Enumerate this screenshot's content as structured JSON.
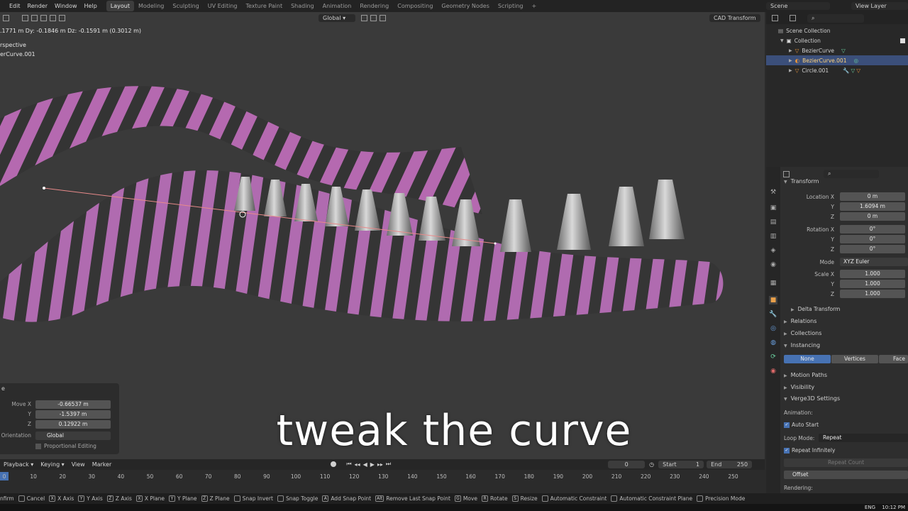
{
  "app": {
    "menus": [
      "Edit",
      "Render",
      "Window",
      "Help"
    ],
    "workspaces": [
      "Layout",
      "Modeling",
      "Sculpting",
      "UV Editing",
      "Texture Paint",
      "Shading",
      "Animation",
      "Rendering",
      "Compositing",
      "Geometry Nodes",
      "Scripting"
    ],
    "active_workspace": "Layout",
    "add_tab": "+",
    "scene": "Scene",
    "view_layer": "View Layer"
  },
  "viewport": {
    "transform_readout": ".1771 m  Dy: -0.1846 m  Dz: -0.1591 m (0.3012 m)",
    "view_name": "rspective",
    "object_name": "erCurve.001",
    "orientation": "Global",
    "transform_mode": "CAD Transform",
    "colors": {
      "stripe_pink": "#b569b0",
      "stripe_dark": "#333333",
      "curve_line": "#e88a8a"
    }
  },
  "operator_panel": {
    "title": "e",
    "move_x_label": "Move X",
    "move_x": "-0.66537 m",
    "y_label": "Y",
    "y": "-1.5397 m",
    "z_label": "Z",
    "z": "0.12922 m",
    "orientation_label": "Orientation",
    "orientation": "Global",
    "proportional_label": "Proportional Editing"
  },
  "subtitle": "tweak the curve",
  "outliner": {
    "scene_collection": "Scene Collection",
    "collection": "Collection",
    "items": [
      {
        "name": "BezierCurve",
        "selected": false
      },
      {
        "name": "BezierCurve.001",
        "selected": true
      },
      {
        "name": "Circle.001",
        "selected": false
      }
    ]
  },
  "properties": {
    "transform_title": "Transform",
    "location_label": "Location X",
    "location": [
      "0 m",
      "1.6094 m",
      "0 m"
    ],
    "rotation_label": "Rotation X",
    "rotation": [
      "0°",
      "0°",
      "0°"
    ],
    "mode_label": "Mode",
    "mode": "XYZ Euler",
    "scale_label": "Scale X",
    "scale": [
      "1.000",
      "1.000",
      "1.000"
    ],
    "y_label": "Y",
    "z_label": "Z",
    "delta_transform": "Delta Transform",
    "relations": "Relations",
    "collections": "Collections",
    "instancing": "Instancing",
    "instancing_options": [
      "None",
      "Vertices",
      "Face"
    ],
    "motion_paths": "Motion Paths",
    "visibility": "Visibility",
    "verge3d": "Verge3D Settings",
    "animation_label": "Animation:",
    "auto_start": "Auto Start",
    "loop_mode_label": "Loop Mode:",
    "loop_mode": "Repeat",
    "repeat_infinitely": "Repeat Infinitely",
    "repeat_count": "Repeat Count",
    "offset": "Offset",
    "rendering_label": "Rendering:"
  },
  "timeline": {
    "menus": [
      "Playback",
      "Keying",
      "View",
      "Marker"
    ],
    "current_frame": "0",
    "start_label": "Start",
    "start": "1",
    "end_label": "End",
    "end": "250",
    "ticks": [
      "0",
      "10",
      "20",
      "30",
      "40",
      "50",
      "60",
      "70",
      "80",
      "90",
      "100",
      "110",
      "120",
      "130",
      "140",
      "150",
      "160",
      "170",
      "180",
      "190",
      "200",
      "210",
      "220",
      "230",
      "240",
      "250"
    ]
  },
  "statusbar": {
    "items": [
      {
        "key": "",
        "label": "nfirm"
      },
      {
        "key": "",
        "label": "Cancel"
      },
      {
        "key": "X",
        "label": "X Axis"
      },
      {
        "key": "Y",
        "label": "Y Axis"
      },
      {
        "key": "Z",
        "label": "Z Axis"
      },
      {
        "key": "X",
        "label": "X Plane"
      },
      {
        "key": "Y",
        "label": "Y Plane"
      },
      {
        "key": "Z",
        "label": "Z Plane"
      },
      {
        "key": "",
        "label": "Snap Invert"
      },
      {
        "key": "",
        "label": "Snap Toggle"
      },
      {
        "key": "A",
        "label": "Add Snap Point"
      },
      {
        "key": "Alt",
        "label": "Remove Last Snap Point"
      },
      {
        "key": "G",
        "label": "Move"
      },
      {
        "key": "R",
        "label": "Rotate"
      },
      {
        "key": "S",
        "label": "Resize"
      },
      {
        "key": "",
        "label": "Automatic Constraint"
      },
      {
        "key": "",
        "label": "Automatic Constraint Plane"
      },
      {
        "key": "",
        "label": "Precision Mode"
      }
    ]
  },
  "taskbar": {
    "lang": "ENG",
    "time": "10:12 PM"
  }
}
